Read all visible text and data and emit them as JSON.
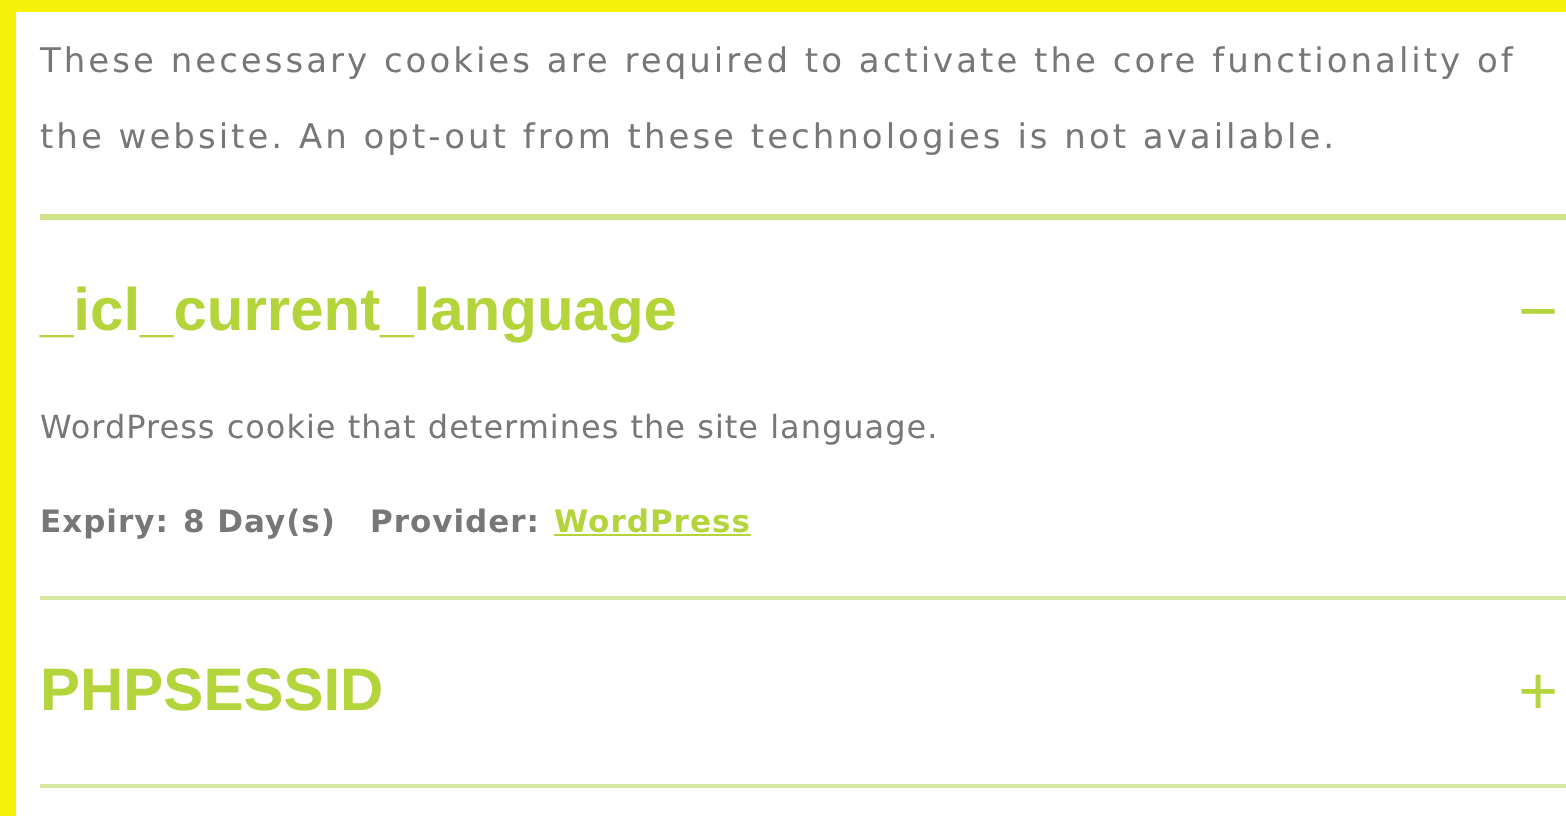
{
  "intro": "These necessary cookies are required to activate the core functionality of the website. An opt-out from these technologies is not available.",
  "cookies": [
    {
      "name": "_icl_current_language",
      "toggle": "−",
      "expanded": true,
      "description": "WordPress cookie that determines the site language.",
      "expiry_label": "Expiry:",
      "expiry": "8 Day(s)",
      "provider_label": "Provider:",
      "provider": "WordPress"
    },
    {
      "name": "PHPSESSID",
      "toggle": "+",
      "expanded": false
    }
  ]
}
